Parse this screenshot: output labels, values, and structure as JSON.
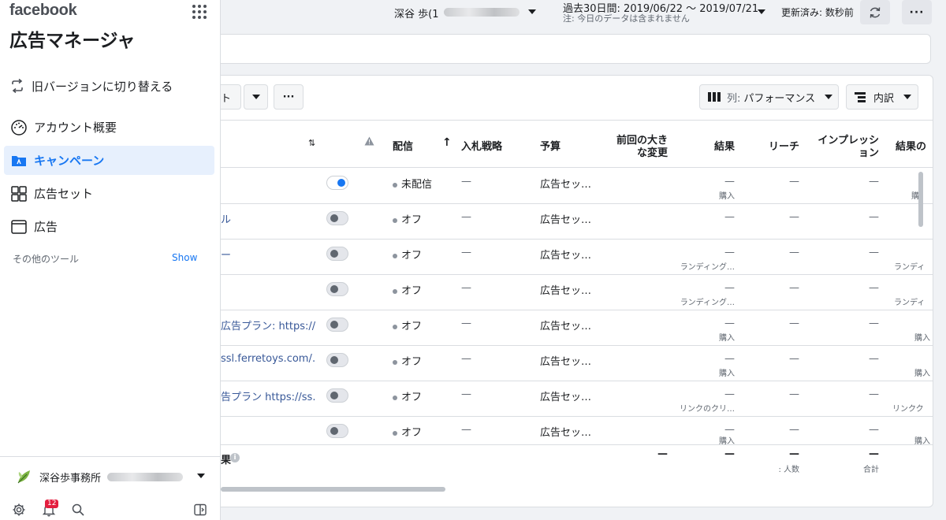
{
  "sidebar": {
    "brand": "facebook",
    "app_title": "広告マネージャ",
    "switch_version": "旧バージョンに切り替える",
    "nav": [
      {
        "label": "アカウント概要"
      },
      {
        "label": "キャンペーン"
      },
      {
        "label": "広告セット"
      },
      {
        "label": "広告"
      }
    ],
    "other_tools": "その他のツール",
    "show_label": "Show",
    "account_name": "深谷歩事務所",
    "notification_count": "12"
  },
  "topbar": {
    "user_name": "深谷 歩(1",
    "date_range": "過去30日間: 2019/06/22 〜 2019/07/21",
    "date_note": "注: 今日のデータは含まれません",
    "updated": "更新済み: 数秒前"
  },
  "toolbar": {
    "left_label_fragment": "ト",
    "columns_prefix": "列:",
    "columns_value": "パフォーマンス",
    "breakdown": "内訳"
  },
  "table": {
    "headers": {
      "delivery": "配信",
      "bid_strategy": "入札戦略",
      "budget": "予算",
      "recent_changes_1": "前回の大き",
      "recent_changes_2": "な変更",
      "results": "結果",
      "reach": "リーチ",
      "impressions_1": "インプレッシ",
      "impressions_2": "ョン",
      "cost_per_result": "結果の"
    },
    "rows": [
      {
        "name": "",
        "delivery": "未配信",
        "bid": "—",
        "budget": "広告セッ…",
        "results": "—",
        "results_sub": "購入",
        "reach": "—",
        "impressions": "—",
        "cost_sub": "購"
      },
      {
        "name": "ル",
        "delivery": "オフ",
        "bid": "—",
        "budget": "広告セッ…",
        "results": "—",
        "results_sub": "",
        "reach": "—",
        "impressions": "—",
        "cost_sub": ""
      },
      {
        "name": "ー",
        "delivery": "オフ",
        "bid": "—",
        "budget": "広告セッ…",
        "results": "—",
        "results_sub": "ランディング…",
        "reach": "—",
        "impressions": "—",
        "cost_sub": "ランディ"
      },
      {
        "name": "",
        "delivery": "オフ",
        "bid": "—",
        "budget": "広告セッ…",
        "results": "—",
        "results_sub": "ランディング…",
        "reach": "—",
        "impressions": "—",
        "cost_sub": "ランディ"
      },
      {
        "name": "広告プラン: https://…",
        "delivery": "オフ",
        "bid": "—",
        "budget": "広告セッ…",
        "results": "—",
        "results_sub": "購入",
        "reach": "—",
        "impressions": "—",
        "cost_sub": "購入"
      },
      {
        "name": "ssl.ferretoys.com/…",
        "delivery": "オフ",
        "bid": "—",
        "budget": "広告セッ…",
        "results": "—",
        "results_sub": "購入",
        "reach": "—",
        "impressions": "—",
        "cost_sub": "購入"
      },
      {
        "name": "告プラン https://ss…",
        "delivery": "オフ",
        "bid": "—",
        "budget": "広告セッ…",
        "results": "—",
        "results_sub": "リンクのクリ…",
        "reach": "—",
        "impressions": "—",
        "cost_sub": "リンクク"
      },
      {
        "name": "",
        "delivery": "オフ",
        "bid": "—",
        "budget": "広告セッ…",
        "results": "—",
        "results_sub": "購入",
        "reach": "—",
        "impressions": "—",
        "cost_sub": "購入"
      }
    ],
    "totals": {
      "label_fragment": "果",
      "changes": "—",
      "results": "—",
      "reach": "—",
      "reach_sub": ": 人数",
      "impressions": "—",
      "impressions_sub": "合計"
    }
  },
  "colors": {
    "accent": "#1877f2",
    "link": "#385898",
    "active_bg": "#e7f0fd"
  }
}
